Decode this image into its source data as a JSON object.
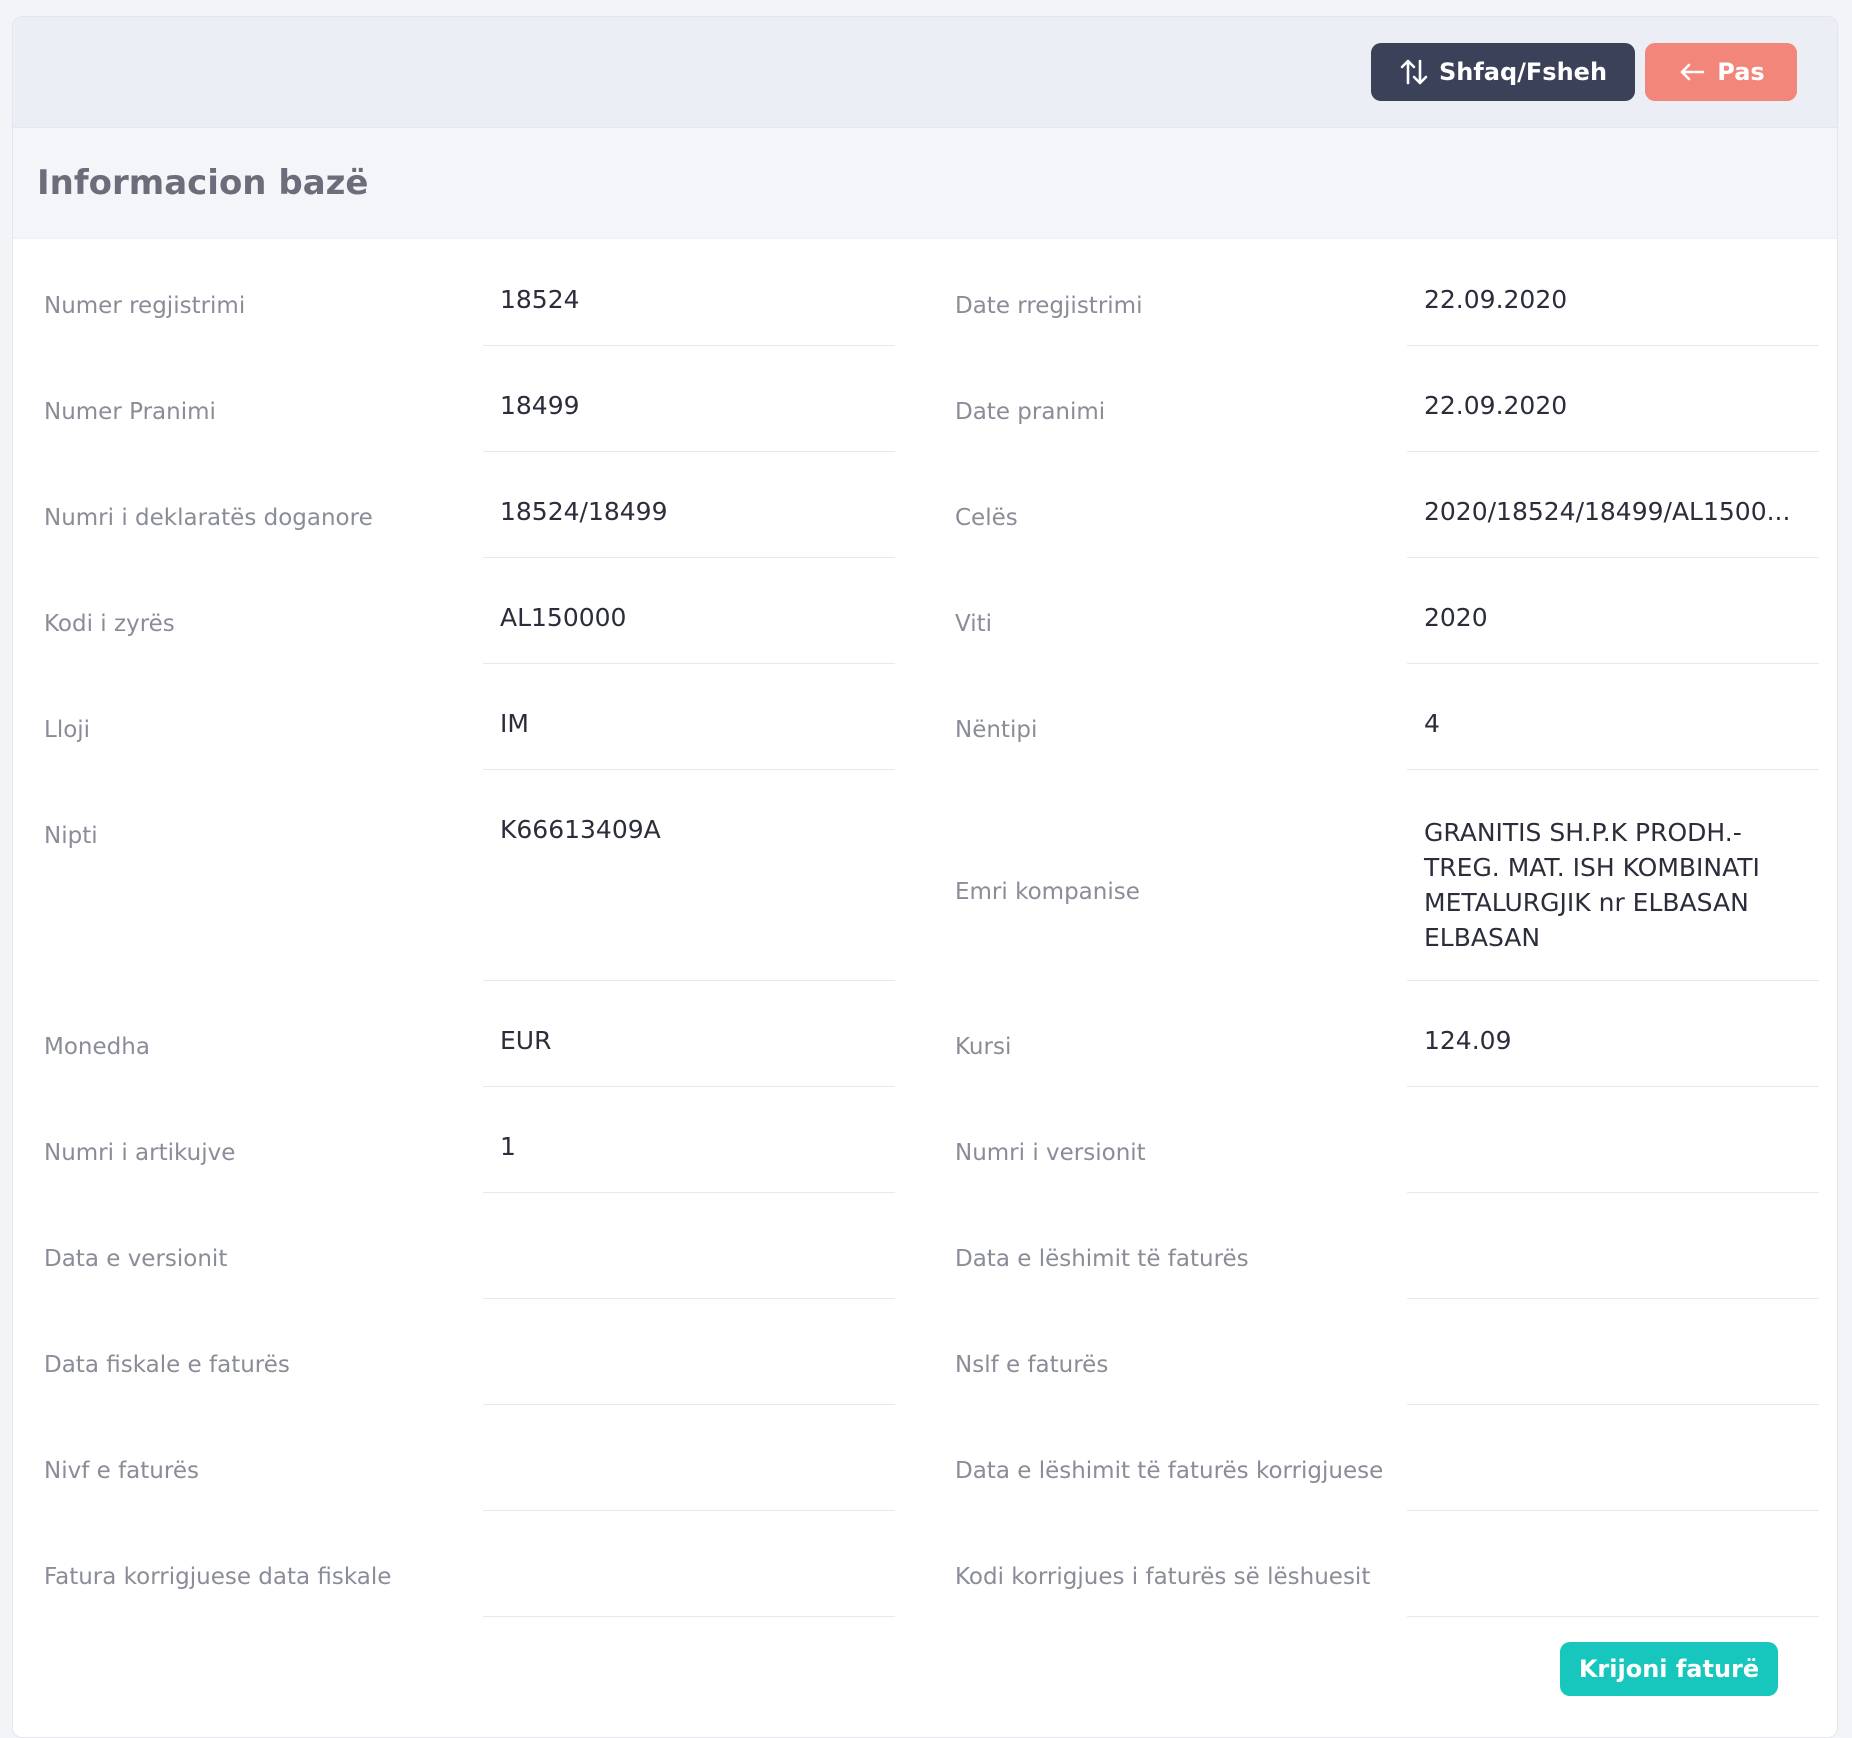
{
  "toolbar": {
    "toggle_label": "Shfaq/Fsheh",
    "toggle_icon": "sort-arrows-icon",
    "back_label": "Pas",
    "back_icon": "arrow-left-icon"
  },
  "section": {
    "title": "Informacion bazë"
  },
  "fields": [
    {
      "left_label": "Numer regjistrimi",
      "left_value": "18524",
      "right_label": "Date rregjistrimi",
      "right_value": "22.09.2020"
    },
    {
      "left_label": "Numer Pranimi",
      "left_value": "18499",
      "right_label": "Date pranimi",
      "right_value": "22.09.2020"
    },
    {
      "left_label": "Numri i deklaratës doganore",
      "left_value": "18524/18499",
      "right_label": "Celës",
      "right_value": "2020/18524/18499/AL1500..."
    },
    {
      "left_label": "Kodi i zyrës",
      "left_value": "AL150000",
      "right_label": "Viti",
      "right_value": "2020"
    },
    {
      "left_label": "Lloji",
      "left_value": "IM",
      "right_label": "Nëntipi",
      "right_value": "4"
    },
    {
      "left_label": "Nipti",
      "left_value": "K66613409A",
      "right_label": "Emri kompanise",
      "right_value": "GRANITIS SH.P.K PRODH.- TREG. MAT. ISH KOMBINATI METALURGJIK nr ELBASAN ELBASAN"
    },
    {
      "left_label": "Monedha",
      "left_value": "EUR",
      "right_label": "Kursi",
      "right_value": "124.09"
    },
    {
      "left_label": "Numri i artikujve",
      "left_value": "1",
      "right_label": "Numri i versionit",
      "right_value": ""
    },
    {
      "left_label": "Data e versionit",
      "left_value": "",
      "right_label": "Data e lëshimit të faturës",
      "right_value": ""
    },
    {
      "left_label": "Data fiskale e faturës",
      "left_value": "",
      "right_label": "Nslf e faturës",
      "right_value": ""
    },
    {
      "left_label": "Nivf e faturës",
      "left_value": "",
      "right_label": "Data e lëshimit të faturës korrigjuese",
      "right_value": ""
    },
    {
      "left_label": "Fatura korrigjuese data fiskale",
      "left_value": "",
      "right_label": "Kodi korrigjues i faturës së lëshuesit",
      "right_value": ""
    }
  ],
  "actions": {
    "create_invoice_label": "Krijoni faturë"
  },
  "colors": {
    "toggle_bg": "#3b4159",
    "back_bg": "#f2867a",
    "create_bg": "#17c7bd"
  }
}
